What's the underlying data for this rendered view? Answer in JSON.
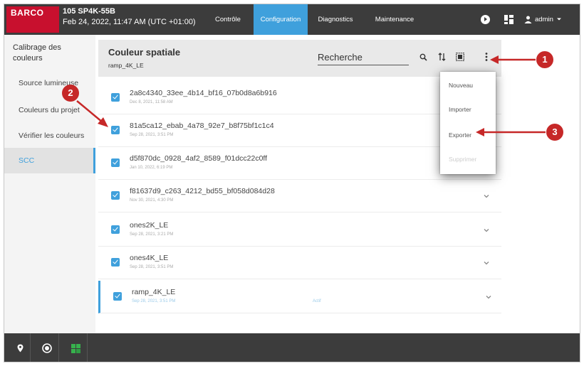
{
  "brand": {
    "logo_text": "BARCO"
  },
  "device": {
    "name": "105 SP4K-55B",
    "datetime": "Feb 24, 2022, 11:47 AM (UTC +01:00)"
  },
  "nav": {
    "tabs": [
      {
        "label": "Contrôle"
      },
      {
        "label": "Configuration",
        "active": true
      },
      {
        "label": "Diagnostics"
      },
      {
        "label": "Maintenance"
      }
    ]
  },
  "user": {
    "name": "admin"
  },
  "sidebar": {
    "title": "Calibrage des couleurs",
    "items": [
      {
        "label": "Source lumineuse"
      },
      {
        "label": "Couleurs du projet"
      },
      {
        "label": "Vérifier les couleurs"
      },
      {
        "label": "SCC",
        "active": true
      }
    ]
  },
  "header": {
    "title": "Couleur spatiale",
    "subtitle": "ramp_4K_LE",
    "search_value": "Recherche"
  },
  "list": {
    "rows": [
      {
        "title": "2a8c4340_33ee_4b14_bf16_07b0d8a6b916",
        "date": "Dec 8, 2021, 11:58 AM"
      },
      {
        "title": "81a5ca12_ebab_4a78_92e7_b8f75bf1c1c4",
        "date": "Sep 28, 2021, 3:51 PM"
      },
      {
        "title": "d5f870dc_0928_4af2_8589_f01dcc22c0ff",
        "date": "Jan 10, 2022, 6:19 PM"
      },
      {
        "title": "f81637d9_c263_4212_bd55_bf058d084d28",
        "date": "Nov 30, 2021, 4:30 PM"
      },
      {
        "title": "ones2K_LE",
        "date": "Sep 28, 2021, 3:21 PM"
      },
      {
        "title": "ones4K_LE",
        "date": "Sep 28, 2021, 3:51 PM"
      },
      {
        "title": "ramp_4K_LE",
        "date": "Sep 28, 2021, 3:51 PM",
        "badge": "Actif",
        "active": true
      }
    ]
  },
  "menu": {
    "items": [
      {
        "label": "Nouveau"
      },
      {
        "label": "Importer"
      },
      {
        "label": "Exporter"
      },
      {
        "label": "Supprimer",
        "disabled": true
      }
    ]
  },
  "callouts": {
    "one": "1",
    "two": "2",
    "three": "3"
  },
  "colors": {
    "accent": "#3fa0dc",
    "brand": "#c8102e",
    "callout": "#c62828",
    "bar": "#3c3c3c"
  }
}
